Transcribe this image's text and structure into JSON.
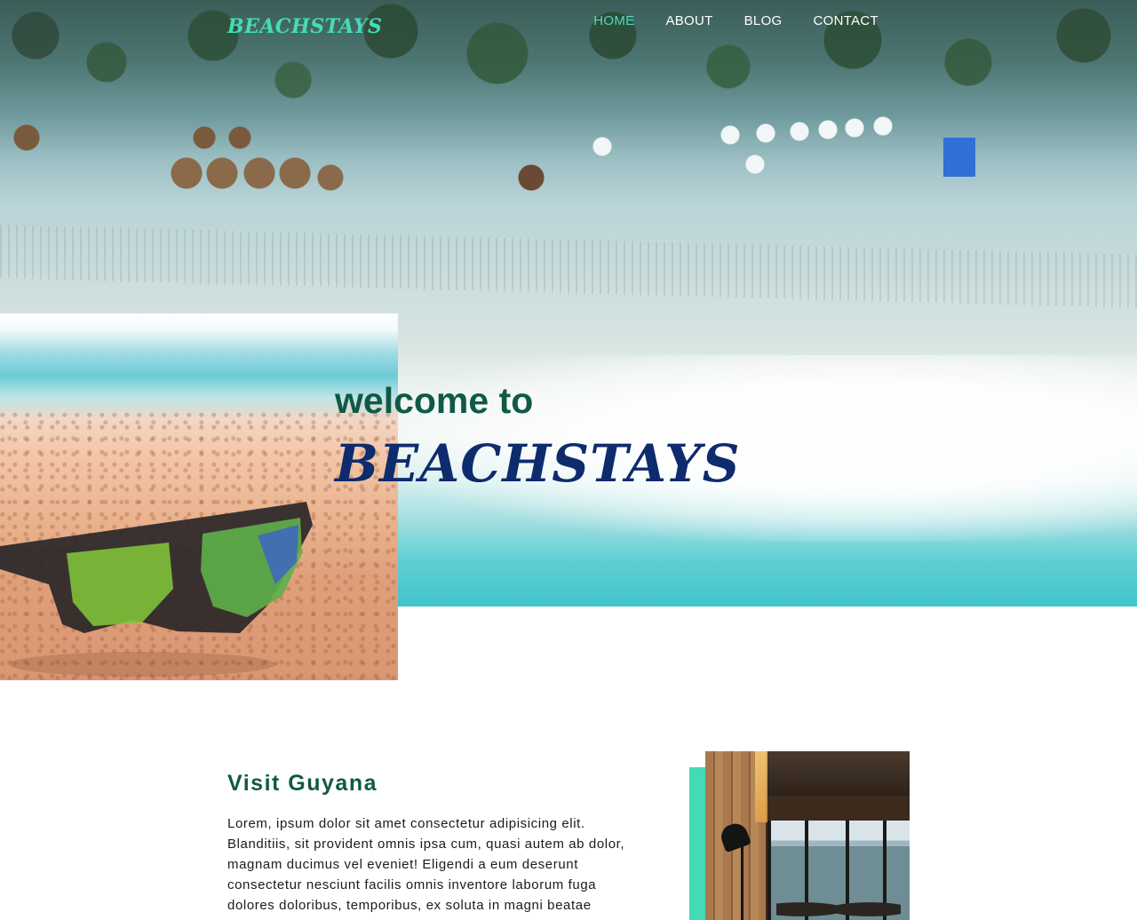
{
  "header": {
    "logo": "BeachStays",
    "nav": [
      {
        "label": "HOME",
        "active": true
      },
      {
        "label": "ABOUT",
        "active": false
      },
      {
        "label": "BLOG",
        "active": false
      },
      {
        "label": "CONTACT",
        "active": false
      }
    ]
  },
  "hero": {
    "welcome": "welcome to",
    "brand": "BeachStays"
  },
  "section": {
    "title": "Visit Guyana",
    "body": "Lorem, ipsum dolor sit amet consectetur adipisicing elit. Blanditiis, sit provident omnis ipsa cum, quasi autem ab dolor, magnam ducimus vel eveniet! Eligendi a eum deserunt consectetur nesciunt facilis omnis inventore laborum fuga dolores doloribus, temporibus, ex soluta in magni beatae"
  },
  "colors": {
    "accent": "#43dbb7",
    "heading_green": "#0f5a46",
    "brand_navy": "#0e2b6e",
    "nav_active": "#4fd9c0"
  }
}
